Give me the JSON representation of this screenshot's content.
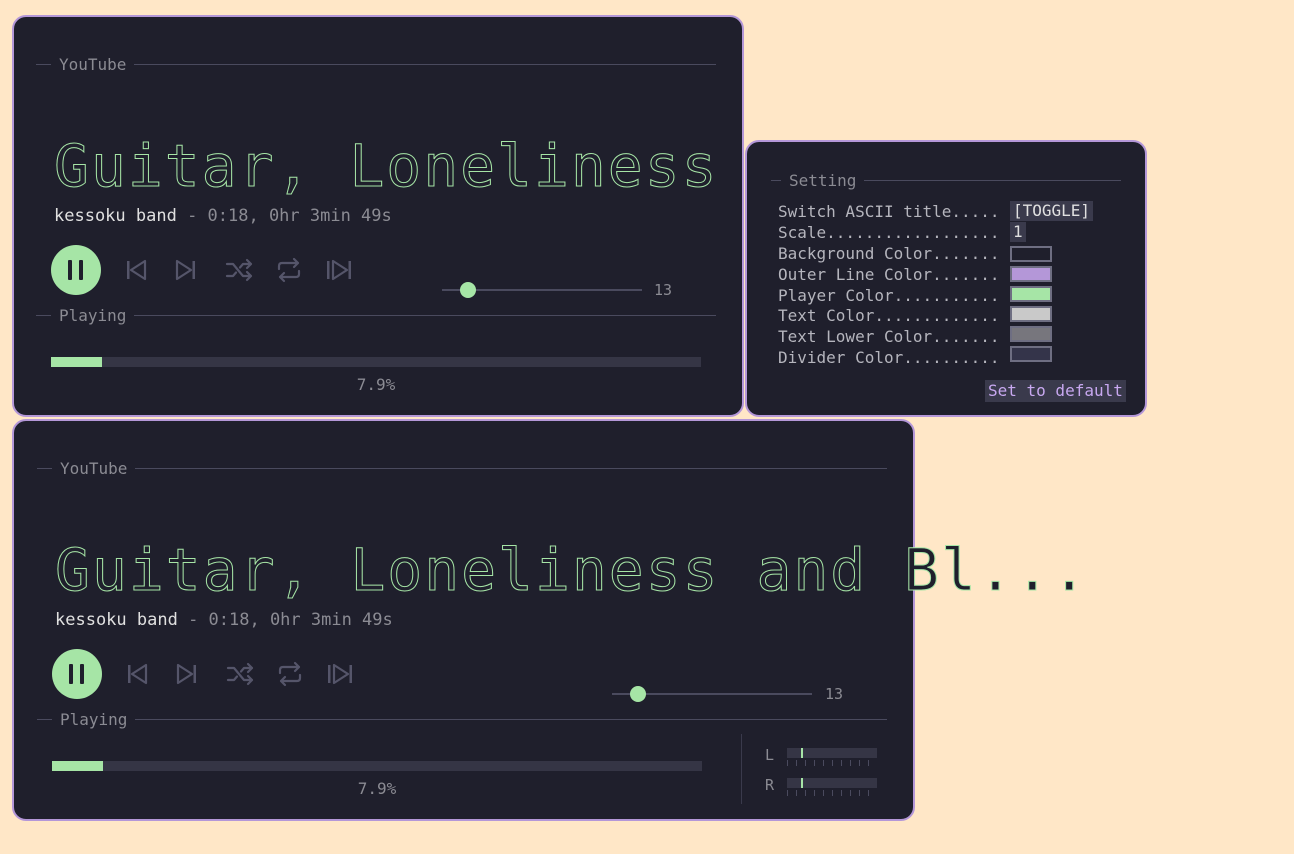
{
  "player1": {
    "source": "YouTube",
    "ascii_title": "Guitar, Loneliness a...",
    "artist": "kessoku band",
    "meta": " - 0:18, 0hr 3min 49s",
    "volume": 13,
    "section_playing": "Playing",
    "progress_percent": "7.9%",
    "progress_value": 0.079
  },
  "player2": {
    "source": "YouTube",
    "ascii_title": "Guitar, Loneliness and Bl...",
    "artist": "kessoku band",
    "meta": " - 0:18, 0hr 3min 49s",
    "volume": 13,
    "section_playing": "Playing",
    "progress_percent": "7.9%",
    "progress_value": 0.079,
    "channels": {
      "left": "L",
      "right": "R"
    }
  },
  "settings": {
    "title": "Setting",
    "rows": [
      {
        "label": "Switch ASCII title.....",
        "value": "[TOGGLE]"
      },
      {
        "label": "Scale..................",
        "value": "1"
      },
      {
        "label": "Background Color.......",
        "color": "#1f1f2c"
      },
      {
        "label": "Outer Line Color.......",
        "color": "#b497d8"
      },
      {
        "label": "Player Color...........",
        "color": "#a6e5a6"
      },
      {
        "label": "Text Color.............",
        "color": "#c9c9c9"
      },
      {
        "label": "Text Lower Color.......",
        "color": "#77767d"
      },
      {
        "label": "Divider Color..........",
        "color": "#34344a"
      }
    ],
    "default_button": "Set to default"
  },
  "icons": {
    "pause": "pause-icon",
    "prev": "skip-previous-icon",
    "next": "skip-next-icon",
    "shuffle": "shuffle-icon",
    "repeat": "repeat-icon",
    "skip_end": "skip-to-end-icon"
  },
  "colors": {
    "page_bg": "#ffe7c7",
    "panel_bg": "#1f1f2c",
    "accent": "#a6e5a6",
    "outline": "#b497d8"
  }
}
